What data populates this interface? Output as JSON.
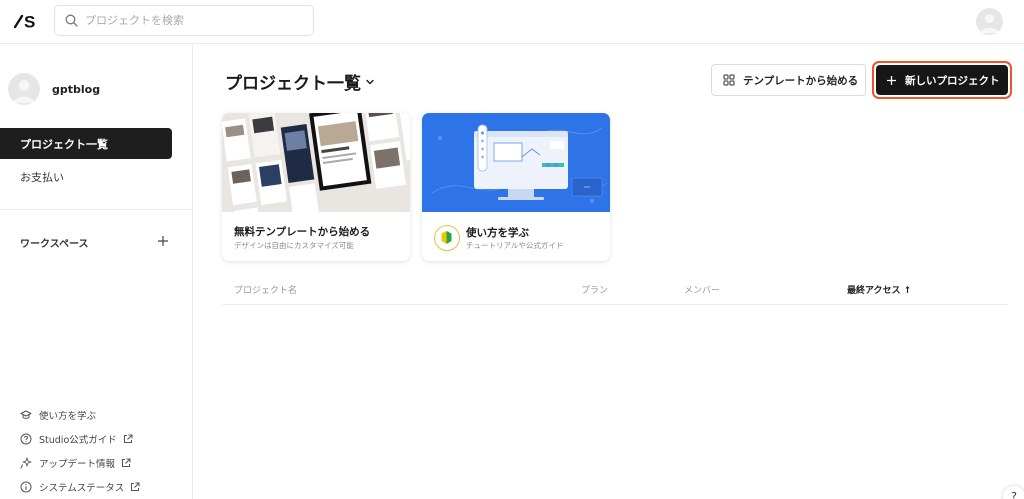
{
  "header": {
    "search": {
      "placeholder": "プロジェクトを検索",
      "value": ""
    }
  },
  "sidebar": {
    "username": "gptblog",
    "nav": {
      "active": "プロジェクト一覧",
      "payments": "お支払い"
    },
    "workspace_label": "ワークスペース",
    "footer_links": [
      {
        "label": "使い方を学ぶ",
        "icon": "graduation-cap-icon"
      },
      {
        "label": "Studio公式ガイド",
        "icon": "question-circle-icon",
        "external": true
      },
      {
        "label": "アップデート情報",
        "icon": "sparkle-icon",
        "external": true
      },
      {
        "label": "システムステータス",
        "icon": "info-circle-icon",
        "external": true
      }
    ]
  },
  "main": {
    "title": "プロジェクト一覧",
    "buttons": {
      "template": "テンプレートから始める",
      "new_project": "新しいプロジェクト"
    },
    "cards": [
      {
        "title": "無料テンプレートから始める",
        "subtitle": "デザインは自由にカスタマイズ可能"
      },
      {
        "title": "使い方を学ぶ",
        "subtitle": "チュートリアルや公式ガイド"
      }
    ],
    "table": {
      "columns": [
        "プロジェクト名",
        "プラン",
        "メンバー",
        "最終アクセス ↑"
      ]
    }
  },
  "help_label": "?",
  "colors": {
    "accent_ring": "#f0522c",
    "dark_button": "#161616",
    "learn_card_bg": "#2f73e8"
  }
}
